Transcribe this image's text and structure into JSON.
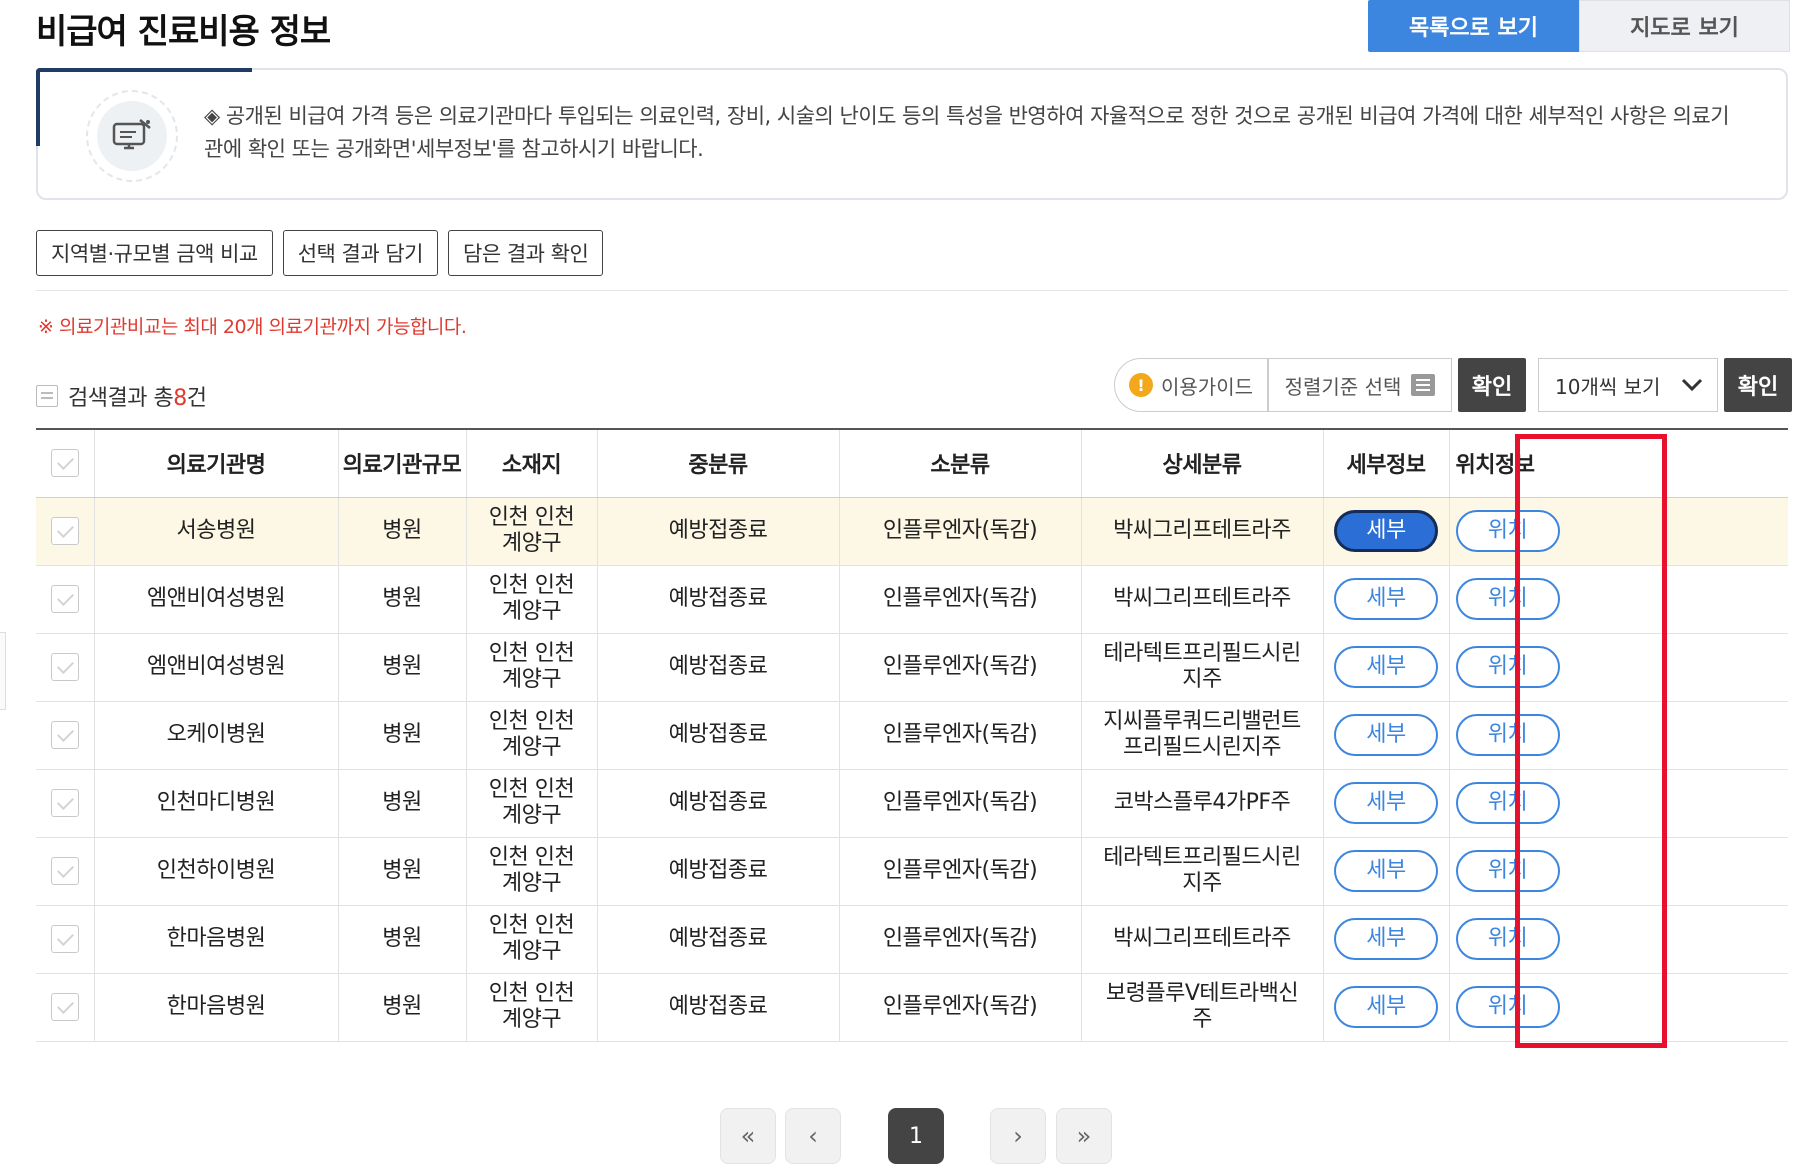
{
  "page": {
    "title": "비급여 진료비용 정보"
  },
  "view_tabs": [
    {
      "label": "목록으로 보기",
      "active": true
    },
    {
      "label": "지도로 보기",
      "active": false
    }
  ],
  "notice": {
    "text": "◈ 공개된 비급여 가격 등은 의료기관마다 투입되는 의료인력, 장비, 시술의 난이도 등의 특성을 반영하여 자율적으로 정한 것으로 공개된 비급여 가격에 대한 세부적인 사항은 의료기관에 확인 또는 공개화면'세부정보'를 참고하시기 바랍니다.",
    "icon": "monitor-icon"
  },
  "actions": [
    "지역별·규모별 금액 비교",
    "선택 결과 담기",
    "담은 결과 확인"
  ],
  "warning": "※ 의료기관비교는 최대 20개 의료기관까지 가능합니다.",
  "result": {
    "prefix": "검색결과 총",
    "count": "8",
    "suffix": "건"
  },
  "controls": {
    "guide_label": "이용가이드",
    "sort_label": "정렬기준 선택",
    "confirm_label": "확인",
    "per_page": "10개씩 보기"
  },
  "table": {
    "headers": [
      "의료기관명",
      "의료기관규모",
      "소재지",
      "중분류",
      "소분류",
      "상세분류",
      "세부정보",
      "위치정보"
    ],
    "detail_label": "세부",
    "location_label": "위치",
    "rows": [
      {
        "name": "서송병원",
        "size": "병원",
        "location": "인천 인천계양구",
        "mid": "예방접종료",
        "sub": "인플루엔자(독감)",
        "detail": "박씨그리프테트라주",
        "highlight": true
      },
      {
        "name": "엠앤비여성병원",
        "size": "병원",
        "location": "인천 인천계양구",
        "mid": "예방접종료",
        "sub": "인플루엔자(독감)",
        "detail": "박씨그리프테트라주",
        "highlight": false
      },
      {
        "name": "엠앤비여성병원",
        "size": "병원",
        "location": "인천 인천계양구",
        "mid": "예방접종료",
        "sub": "인플루엔자(독감)",
        "detail": "테라텍트프리필드시린지주",
        "highlight": false
      },
      {
        "name": "오케이병원",
        "size": "병원",
        "location": "인천 인천계양구",
        "mid": "예방접종료",
        "sub": "인플루엔자(독감)",
        "detail": "지씨플루쿼드리밸런트프리필드시린지주",
        "highlight": false
      },
      {
        "name": "인천마디병원",
        "size": "병원",
        "location": "인천 인천계양구",
        "mid": "예방접종료",
        "sub": "인플루엔자(독감)",
        "detail": "코박스플루4가PF주",
        "highlight": false
      },
      {
        "name": "인천하이병원",
        "size": "병원",
        "location": "인천 인천계양구",
        "mid": "예방접종료",
        "sub": "인플루엔자(독감)",
        "detail": "테라텍트프리필드시린지주",
        "highlight": false
      },
      {
        "name": "한마음병원",
        "size": "병원",
        "location": "인천 인천계양구",
        "mid": "예방접종료",
        "sub": "인플루엔자(독감)",
        "detail": "박씨그리프테트라주",
        "highlight": false
      },
      {
        "name": "한마음병원",
        "size": "병원",
        "location": "인천 인천계양구",
        "mid": "예방접종료",
        "sub": "인플루엔자(독감)",
        "detail": "보령플루V테트라백신주",
        "highlight": false
      }
    ]
  },
  "pagination": {
    "first": "«",
    "prev": "‹",
    "current": "1",
    "next": "›",
    "last": "»"
  }
}
